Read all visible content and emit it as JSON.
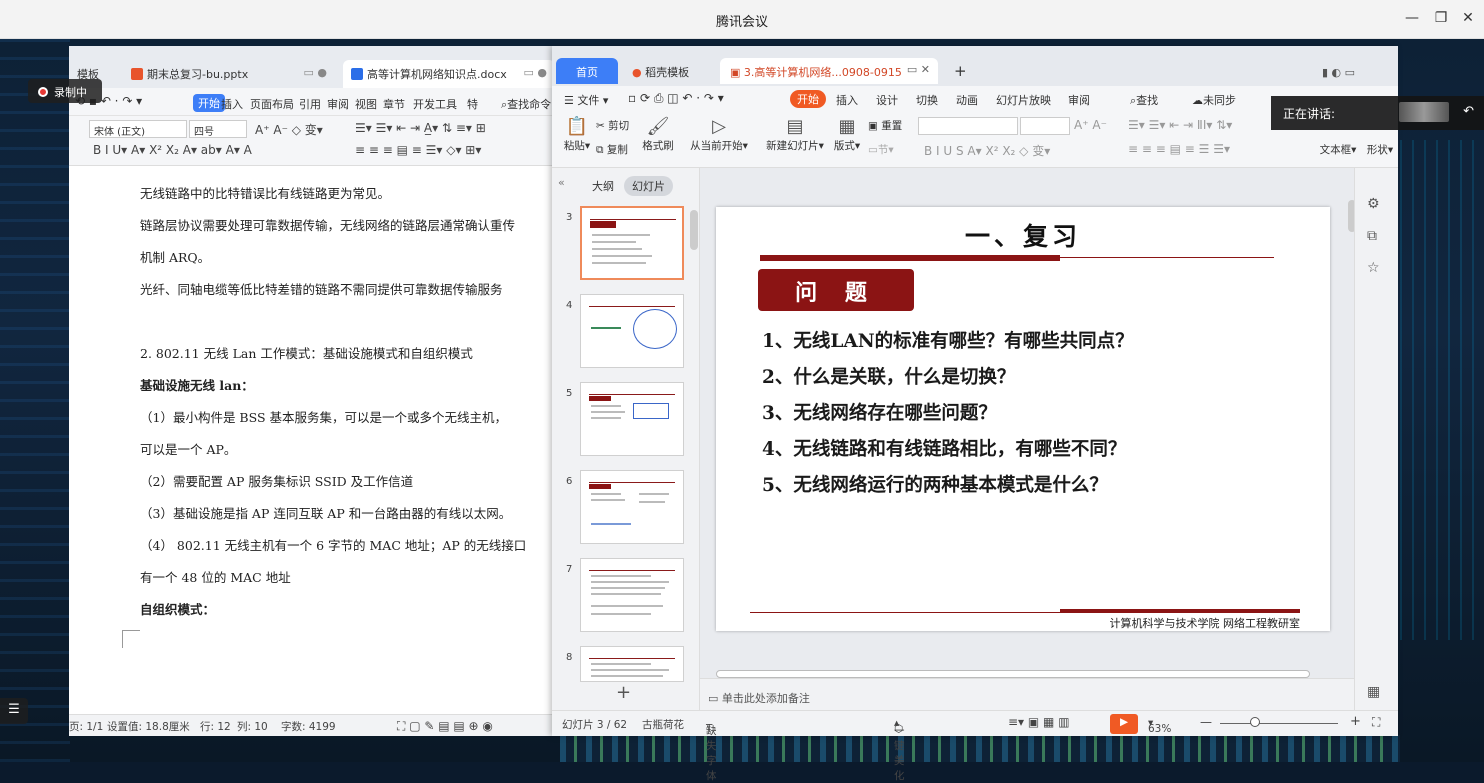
{
  "app": {
    "title": "腾讯会议",
    "recording_label": "录制中",
    "speaking_label": "正在讲话:"
  },
  "writer": {
    "tabs": [
      "模板",
      "期末总复习-bu.pptx",
      "高等计算机网络知识点.docx"
    ],
    "menu": [
      "开始",
      "插入",
      "页面布局",
      "引用",
      "审阅",
      "视图",
      "章节",
      "开发工具",
      "特"
    ],
    "search_label": "查找命令",
    "font_name": "宋体 (正文)",
    "font_size": "四号",
    "body": [
      "无线链路中的比特错误比有线链路更为常见。",
      "链路层协议需要处理可靠数据传输，无线网络的链路层通常确认重传",
      "机制 ARQ。",
      "光纤、同轴电缆等低比特差错的链路不需同提供可靠数据传输服务",
      "2.  802.11 无线 Lan 工作模式：基础设施模式和自组织模式",
      "基础设施无线 lan：",
      "（1）最小构件是 BSS 基本服务集，可以是一个或多个无线主机，",
      "可以是一个 AP。",
      "（2）需要配置 AP 服务集标识 SSID 及工作信道",
      "（3）基础设施是指 AP 连同互联 AP 和一台路由器的有线以太网。",
      "（4）  802.11 无线主机有一个 6 字节的 MAC 地址；AP 的无线接口",
      "有一个 48 位的 MAC 地址",
      "自组织模式："
    ],
    "status": {
      "page": "页: 1/1",
      "setting": "设置值: 18.8厘米",
      "row": "行: 12",
      "col": "列: 10",
      "words": "字数: 4199"
    }
  },
  "ppt": {
    "tabs": [
      "首页",
      "稻壳模板",
      "3.高等计算机网络...0908-0915"
    ],
    "menu": [
      "文件",
      "开始",
      "插入",
      "设计",
      "切换",
      "动画",
      "幻灯片放映",
      "审阅"
    ],
    "search_label": "查找",
    "sync_label": "未同步",
    "ribbon": {
      "paste": "粘贴",
      "cut": "剪切",
      "copy": "复制",
      "format_painter": "格式刷",
      "from_current": "从当前开始",
      "new_slide": "新建幻灯片",
      "layout": "版式",
      "section": "节",
      "reset": "重置",
      "textbox": "文本框",
      "shape": "形状"
    },
    "panel_tabs": [
      "大纲",
      "幻灯片"
    ],
    "thumb_numbers": [
      "3",
      "4",
      "5",
      "6",
      "7",
      "8"
    ],
    "slide": {
      "title": "一、复习",
      "badge": "问 题",
      "questions": [
        "1、无线LAN的标准有哪些？有哪些共同点？",
        "2、什么是关联，什么是切换？",
        "3、无线网络存在哪些问题？",
        "4、无线链路和有线链路相比，有哪些不同？",
        "5、无线网络运行的两种基本模式是什么？"
      ],
      "footer": "计算机科学与技术学院 网络工程教研室"
    },
    "notes_placeholder": "单击此处添加备注",
    "status": {
      "slide_count": "幻灯片 3 / 62",
      "theme": "古瓶荷花",
      "missing_font": "缺失字体",
      "beautify": "一键美化",
      "zoom": "63%"
    }
  },
  "colors": {
    "accent_blue": "#3d7ef7",
    "slide_red": "#8b1414",
    "start_orange": "#f05a24"
  }
}
